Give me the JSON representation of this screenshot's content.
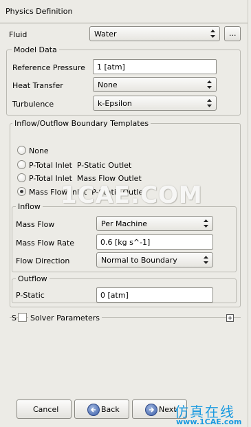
{
  "panel_title": "Physics Definition",
  "fluid": {
    "label": "Fluid",
    "value": "Water",
    "more_label": "..."
  },
  "model_data": {
    "title": "Model Data",
    "reference_pressure": {
      "label": "Reference Pressure",
      "value": "1 [atm]"
    },
    "heat_transfer": {
      "label": "Heat Transfer",
      "value": "None"
    },
    "turbulence": {
      "label": "Turbulence",
      "value": "k-Epsilon"
    }
  },
  "templates": {
    "title": "Inflow/Outflow Boundary Templates",
    "options": [
      {
        "label": "None",
        "selected": false
      },
      {
        "label": "P-Total Inlet  P-Static Outlet",
        "selected": false
      },
      {
        "label": "P-Total Inlet  Mass Flow Outlet",
        "selected": false
      },
      {
        "label": "Mass Flow Inlet  P-Static Outlet",
        "selected": true
      }
    ]
  },
  "inflow": {
    "title": "Inflow",
    "mass_flow": {
      "label": "Mass Flow",
      "value": "Per Machine"
    },
    "mass_flow_rate": {
      "label": "Mass Flow Rate",
      "value": "0.6 [kg s^-1]"
    },
    "flow_direction": {
      "label": "Flow Direction",
      "value": "Normal to Boundary"
    }
  },
  "outflow": {
    "title": "Outflow",
    "p_static": {
      "label": "P-Static",
      "value": "0 [atm]"
    }
  },
  "solver": {
    "clipped_prefix": "S",
    "label": "Solver Parameters",
    "checked": false,
    "expander": "+"
  },
  "buttons": {
    "cancel": "Cancel",
    "back": "Back",
    "next": "Next"
  },
  "watermark": {
    "text": "1CAE.COM",
    "cn": "仿真在线",
    "url": "www.1CAE.com"
  },
  "colors": {
    "background": "#ecebe6",
    "nav_icon": "#3c5ea8",
    "watermark_blue": "#1a9ae0"
  }
}
